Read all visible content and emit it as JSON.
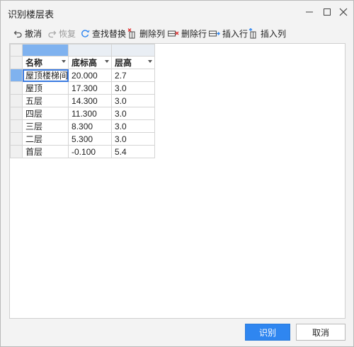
{
  "window": {
    "title": "识别楼层表",
    "minimize_icon": "minimize-icon",
    "maximize_icon": "maximize-icon",
    "close_icon": "close-icon"
  },
  "toolbar": {
    "undo": "撤消",
    "redo": "恢复",
    "find_replace": "查找替换",
    "delete_column": "删除列",
    "delete_row": "删除行",
    "insert_row": "插入行",
    "insert_column": "插入列"
  },
  "table": {
    "headers": [
      "名称",
      "底标高",
      "层高"
    ],
    "rows": [
      [
        "屋顶楼梯间",
        "20.000",
        "2.7"
      ],
      [
        "屋顶",
        "17.300",
        "3.0"
      ],
      [
        "五层",
        "14.300",
        "3.0"
      ],
      [
        "四层",
        "11.300",
        "3.0"
      ],
      [
        "三层",
        "8.300",
        "3.0"
      ],
      [
        "二层",
        "5.300",
        "3.0"
      ],
      [
        "首层",
        "-0.100",
        "5.4"
      ]
    ]
  },
  "buttons": {
    "recognize": "识别",
    "cancel": "取消"
  },
  "colors": {
    "accent": "#2f86f0",
    "selection": "#7fb2ef"
  }
}
